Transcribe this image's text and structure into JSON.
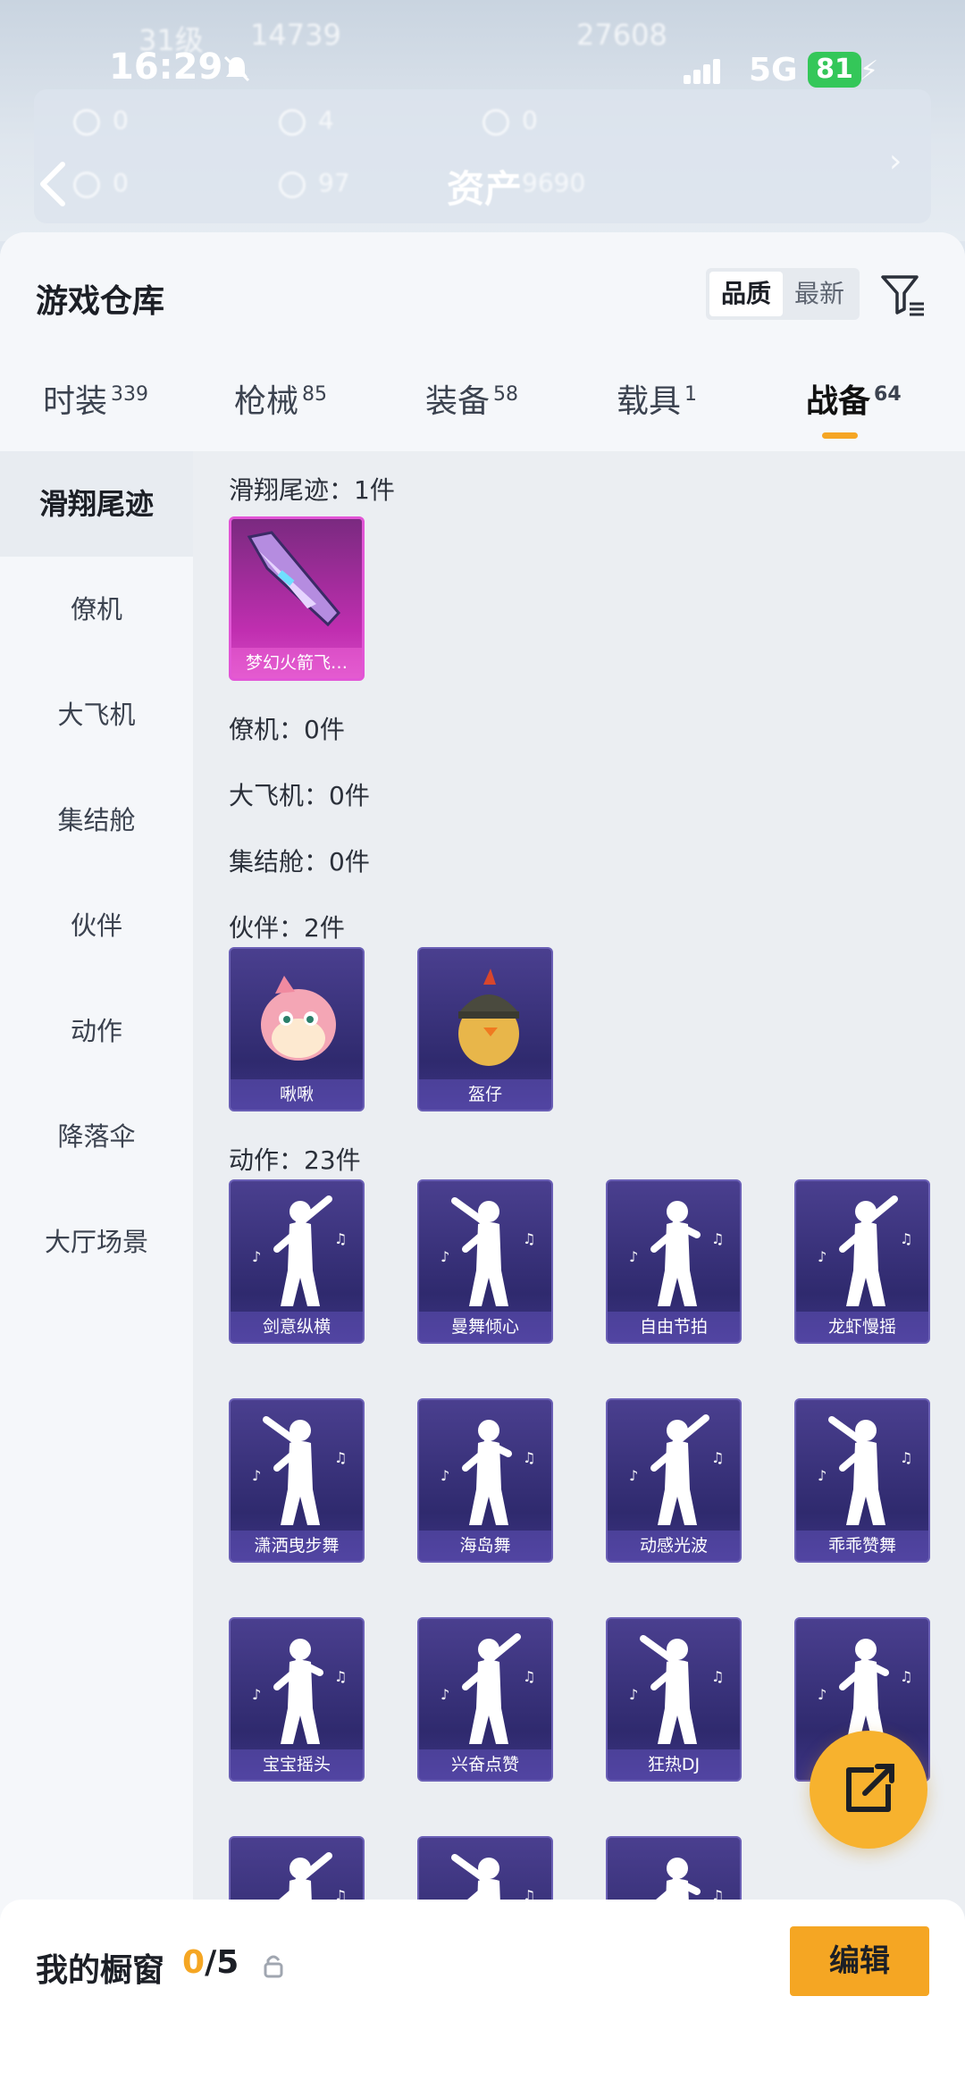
{
  "status_bar": {
    "time": "16:29",
    "network": "5G",
    "battery": "81"
  },
  "header_bg": {
    "title": "资产",
    "ghost_level": "31级",
    "ghost_num1": "14739",
    "ghost_num2": "27608",
    "ghost_stats": [
      "0",
      "4",
      "0",
      "0",
      "97",
      "9690"
    ]
  },
  "sheet": {
    "title": "游戏仓库",
    "sort_options": [
      "品质",
      "最新"
    ],
    "tabs": [
      {
        "label": "时装",
        "count": "339"
      },
      {
        "label": "枪械",
        "count": "85"
      },
      {
        "label": "装备",
        "count": "58"
      },
      {
        "label": "载具",
        "count": "1"
      },
      {
        "label": "战备",
        "count": "64"
      }
    ],
    "sidebar": [
      "滑翔尾迹",
      "僚机",
      "大飞机",
      "集结舱",
      "伙伴",
      "动作",
      "降落伞",
      "大厅场景"
    ],
    "sections": {
      "glide": "滑翔尾迹：1件",
      "wingman": "僚机：0件",
      "plane": "大飞机：0件",
      "pod": "集结舱：0件",
      "partner": "伙伴：2件",
      "emote": "动作：23件"
    },
    "glide_items": [
      "梦幻火箭飞…"
    ],
    "partner_items": [
      "啾啾",
      "盔仔"
    ],
    "emote_items": [
      "剑意纵横",
      "曼舞倾心",
      "自由节拍",
      "龙虾慢摇",
      "潇洒曳步舞",
      "海岛舞",
      "动感光波",
      "乖乖赞舞",
      "宝宝摇头",
      "兴奋点赞",
      "狂热DJ"
    ]
  },
  "bottom": {
    "showcase_label": "我的橱窗",
    "showcase_used": "0",
    "showcase_total": "/5",
    "edit_label": "编辑"
  }
}
